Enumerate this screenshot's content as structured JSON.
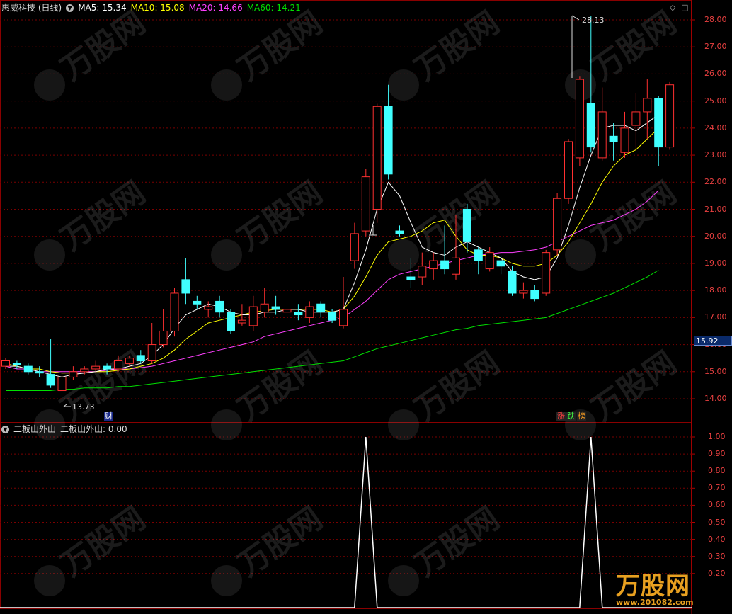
{
  "header": {
    "stock_name": "惠威科技 (日线)",
    "ma5": "MA5: 15.34",
    "ma10": "MA10: 15.08",
    "ma20": "MA20: 14.66",
    "ma60": "MA60: 14.21",
    "colors": {
      "ma5": "#ffffff",
      "ma10": "#ffff00",
      "ma20": "#ff40ff",
      "ma60": "#00e000",
      "up": "#ff3030",
      "down": "#40ffff",
      "grid": "#7a0000"
    }
  },
  "indicator": {
    "name": "二板山外山",
    "value_label": "二板山外山: 0.00"
  },
  "price_axis": {
    "ticks": [
      "28.00",
      "27.00",
      "26.00",
      "25.00",
      "24.00",
      "23.00",
      "22.00",
      "21.00",
      "20.00",
      "19.00",
      "18.00",
      "17.00",
      "16.00",
      "15.00",
      "14.00"
    ],
    "current_price": "15.92"
  },
  "indicator_axis": {
    "ticks": [
      "1.00",
      "0.90",
      "0.80",
      "0.70",
      "0.60",
      "0.50",
      "0.40",
      "0.30",
      "0.20"
    ]
  },
  "annotations": {
    "high": "28.13",
    "low": "13.73",
    "finance_badge": "财",
    "badge_zhang": "涨",
    "badge_die": "跌",
    "badge_bang": "榜"
  },
  "watermark": {
    "logo_text": "万股网",
    "url": "www.201082.com"
  },
  "chart_data": {
    "type": "candlestick",
    "ylim": [
      13.6,
      28.4
    ],
    "series_names": [
      "MA5",
      "MA10",
      "MA20",
      "MA60"
    ],
    "candles": [
      {
        "o": 15.2,
        "c": 15.4,
        "h": 15.5,
        "l": 15.1
      },
      {
        "o": 15.3,
        "c": 15.25,
        "h": 15.4,
        "l": 15.1
      },
      {
        "o": 15.2,
        "c": 15.0,
        "h": 15.3,
        "l": 14.9
      },
      {
        "o": 15.0,
        "c": 14.95,
        "h": 15.2,
        "l": 14.8
      },
      {
        "o": 14.9,
        "c": 14.5,
        "h": 16.2,
        "l": 14.4
      },
      {
        "o": 14.3,
        "c": 14.8,
        "h": 14.9,
        "l": 13.73
      },
      {
        "o": 14.8,
        "c": 15.0,
        "h": 15.2,
        "l": 14.7
      },
      {
        "o": 15.0,
        "c": 15.1,
        "h": 15.2,
        "l": 14.9
      },
      {
        "o": 15.1,
        "c": 15.2,
        "h": 15.4,
        "l": 15.0
      },
      {
        "o": 15.2,
        "c": 15.1,
        "h": 15.3,
        "l": 14.9
      },
      {
        "o": 15.1,
        "c": 15.4,
        "h": 15.6,
        "l": 15.0
      },
      {
        "o": 15.3,
        "c": 15.5,
        "h": 15.6,
        "l": 15.2
      },
      {
        "o": 15.6,
        "c": 15.4,
        "h": 15.8,
        "l": 15.3
      },
      {
        "o": 15.4,
        "c": 16.0,
        "h": 16.8,
        "l": 15.3
      },
      {
        "o": 16.0,
        "c": 16.5,
        "h": 17.3,
        "l": 15.9
      },
      {
        "o": 16.5,
        "c": 17.9,
        "h": 18.1,
        "l": 16.3
      },
      {
        "o": 18.4,
        "c": 17.9,
        "h": 19.2,
        "l": 17.5
      },
      {
        "o": 17.6,
        "c": 17.5,
        "h": 17.8,
        "l": 17.3
      },
      {
        "o": 17.3,
        "c": 17.4,
        "h": 17.6,
        "l": 17.0
      },
      {
        "o": 17.6,
        "c": 17.2,
        "h": 17.8,
        "l": 17.0
      },
      {
        "o": 17.2,
        "c": 16.5,
        "h": 17.3,
        "l": 16.4
      },
      {
        "o": 16.8,
        "c": 16.9,
        "h": 17.5,
        "l": 16.7
      },
      {
        "o": 16.7,
        "c": 17.4,
        "h": 17.8,
        "l": 16.5
      },
      {
        "o": 17.2,
        "c": 17.5,
        "h": 18.1,
        "l": 17.0
      },
      {
        "o": 17.4,
        "c": 17.3,
        "h": 17.8,
        "l": 17.1
      },
      {
        "o": 17.2,
        "c": 17.3,
        "h": 17.6,
        "l": 17.0
      },
      {
        "o": 17.2,
        "c": 17.1,
        "h": 17.5,
        "l": 16.9
      },
      {
        "o": 17.0,
        "c": 17.4,
        "h": 17.6,
        "l": 16.8
      },
      {
        "o": 17.5,
        "c": 17.2,
        "h": 17.6,
        "l": 17.0
      },
      {
        "o": 17.2,
        "c": 16.9,
        "h": 17.3,
        "l": 16.8
      },
      {
        "o": 16.7,
        "c": 17.3,
        "h": 18.5,
        "l": 16.6
      },
      {
        "o": 19.1,
        "c": 20.1,
        "h": 20.5,
        "l": 18.8
      },
      {
        "o": 20.2,
        "c": 22.2,
        "h": 22.5,
        "l": 20.0
      },
      {
        "o": 21.0,
        "c": 24.8,
        "h": 24.9,
        "l": 20.5
      },
      {
        "o": 24.8,
        "c": 22.3,
        "h": 25.6,
        "l": 22.1
      },
      {
        "o": 20.2,
        "c": 20.1,
        "h": 20.4,
        "l": 20.0
      },
      {
        "o": 18.5,
        "c": 18.4,
        "h": 19.2,
        "l": 18.1
      },
      {
        "o": 18.5,
        "c": 18.9,
        "h": 19.4,
        "l": 18.2
      },
      {
        "o": 18.8,
        "c": 19.1,
        "h": 19.4,
        "l": 18.4
      },
      {
        "o": 19.1,
        "c": 18.8,
        "h": 20.4,
        "l": 18.6
      },
      {
        "o": 18.6,
        "c": 19.2,
        "h": 20.8,
        "l": 18.4
      },
      {
        "o": 21.0,
        "c": 19.8,
        "h": 21.2,
        "l": 19.4
      },
      {
        "o": 19.5,
        "c": 19.1,
        "h": 19.6,
        "l": 18.6
      },
      {
        "o": 18.8,
        "c": 19.4,
        "h": 19.6,
        "l": 18.7
      },
      {
        "o": 19.1,
        "c": 18.9,
        "h": 19.3,
        "l": 18.6
      },
      {
        "o": 18.7,
        "c": 17.9,
        "h": 18.9,
        "l": 17.8
      },
      {
        "o": 17.9,
        "c": 18.0,
        "h": 18.3,
        "l": 17.7
      },
      {
        "o": 18.0,
        "c": 17.7,
        "h": 18.2,
        "l": 17.6
      },
      {
        "o": 17.9,
        "c": 19.4,
        "h": 19.5,
        "l": 17.8
      },
      {
        "o": 19.5,
        "c": 21.4,
        "h": 21.6,
        "l": 19.3
      },
      {
        "o": 21.4,
        "c": 23.5,
        "h": 23.6,
        "l": 21.2
      },
      {
        "o": 22.9,
        "c": 25.8,
        "h": 25.9,
        "l": 22.6
      },
      {
        "o": 24.9,
        "c": 23.3,
        "h": 28.13,
        "l": 23.1
      },
      {
        "o": 22.9,
        "c": 24.6,
        "h": 25.5,
        "l": 22.8
      },
      {
        "o": 23.7,
        "c": 23.5,
        "h": 24.2,
        "l": 22.8
      },
      {
        "o": 23.1,
        "c": 24.0,
        "h": 24.6,
        "l": 22.9
      },
      {
        "o": 24.1,
        "c": 24.6,
        "h": 25.3,
        "l": 23.2
      },
      {
        "o": 24.6,
        "c": 25.1,
        "h": 25.8,
        "l": 23.6
      },
      {
        "o": 25.1,
        "c": 23.3,
        "h": 25.2,
        "l": 22.6
      },
      {
        "o": 23.3,
        "c": 25.6,
        "h": 25.7,
        "l": 23.2
      }
    ],
    "ma5": [
      15.2,
      15.2,
      15.1,
      15.0,
      14.9,
      14.8,
      14.9,
      14.95,
      15.0,
      15.1,
      15.1,
      15.2,
      15.3,
      15.6,
      16.0,
      16.6,
      17.1,
      17.3,
      17.5,
      17.4,
      17.2,
      17.1,
      17.1,
      17.2,
      17.2,
      17.3,
      17.3,
      17.2,
      17.2,
      17.2,
      17.3,
      18.3,
      19.5,
      21.0,
      22.0,
      21.5,
      20.5,
      19.6,
      19.4,
      19.3,
      19.6,
      19.8,
      19.6,
      19.4,
      19.2,
      18.7,
      18.5,
      18.4,
      18.5,
      19.2,
      20.4,
      21.8,
      23.0,
      24.0,
      24.1,
      24.1,
      23.9,
      24.2,
      24.5
    ],
    "ma10": [
      15.3,
      15.2,
      15.1,
      15.1,
      15.0,
      14.95,
      14.95,
      14.95,
      15.0,
      15.0,
      15.05,
      15.1,
      15.2,
      15.3,
      15.5,
      15.8,
      16.2,
      16.5,
      16.8,
      16.9,
      17.0,
      17.1,
      17.2,
      17.25,
      17.3,
      17.3,
      17.3,
      17.3,
      17.3,
      17.2,
      17.3,
      17.8,
      18.5,
      19.3,
      19.8,
      19.9,
      20.0,
      20.2,
      20.5,
      20.6,
      20.0,
      19.5,
      19.3,
      19.3,
      19.2,
      19.0,
      18.9,
      18.9,
      19.0,
      19.3,
      19.8,
      20.5,
      21.2,
      22.0,
      22.6,
      23.0,
      23.2,
      23.6,
      24.0
    ],
    "ma20": [
      15.2,
      15.1,
      15.1,
      15.0,
      15.0,
      15.0,
      15.0,
      15.0,
      15.0,
      15.05,
      15.1,
      15.1,
      15.15,
      15.2,
      15.3,
      15.4,
      15.5,
      15.6,
      15.7,
      15.8,
      15.9,
      16.0,
      16.1,
      16.3,
      16.4,
      16.5,
      16.6,
      16.7,
      16.8,
      16.9,
      17.0,
      17.3,
      17.6,
      18.0,
      18.4,
      18.6,
      18.7,
      18.8,
      18.9,
      19.0,
      19.1,
      19.2,
      19.3,
      19.35,
      19.4,
      19.4,
      19.45,
      19.5,
      19.6,
      19.8,
      20.0,
      20.2,
      20.4,
      20.5,
      20.6,
      20.8,
      21.0,
      21.3,
      21.7
    ],
    "ma60": [
      14.3,
      14.3,
      14.3,
      14.3,
      14.3,
      14.35,
      14.35,
      14.4,
      14.4,
      14.4,
      14.45,
      14.45,
      14.5,
      14.55,
      14.6,
      14.65,
      14.7,
      14.75,
      14.8,
      14.85,
      14.9,
      14.95,
      15.0,
      15.05,
      15.1,
      15.15,
      15.2,
      15.25,
      15.3,
      15.35,
      15.4,
      15.55,
      15.7,
      15.85,
      15.95,
      16.05,
      16.15,
      16.25,
      16.35,
      16.45,
      16.55,
      16.6,
      16.7,
      16.75,
      16.8,
      16.85,
      16.9,
      16.95,
      17.0,
      17.15,
      17.3,
      17.45,
      17.6,
      17.75,
      17.9,
      18.1,
      18.3,
      18.5,
      18.75
    ],
    "indicator_values": [
      0,
      0,
      0,
      0,
      0,
      0,
      0,
      0,
      0,
      0,
      0,
      0,
      0,
      0,
      0,
      0,
      0,
      0,
      0,
      0,
      0,
      0,
      0,
      0,
      0,
      0,
      0,
      0,
      0,
      0,
      0,
      0,
      1,
      0,
      0,
      0,
      0,
      0,
      0,
      0,
      0,
      0,
      0,
      0,
      0,
      0,
      0,
      0,
      0,
      0,
      0,
      0,
      1,
      0,
      0,
      0,
      0,
      0,
      0,
      0
    ],
    "indicator_ylim": [
      0,
      1.0
    ]
  }
}
